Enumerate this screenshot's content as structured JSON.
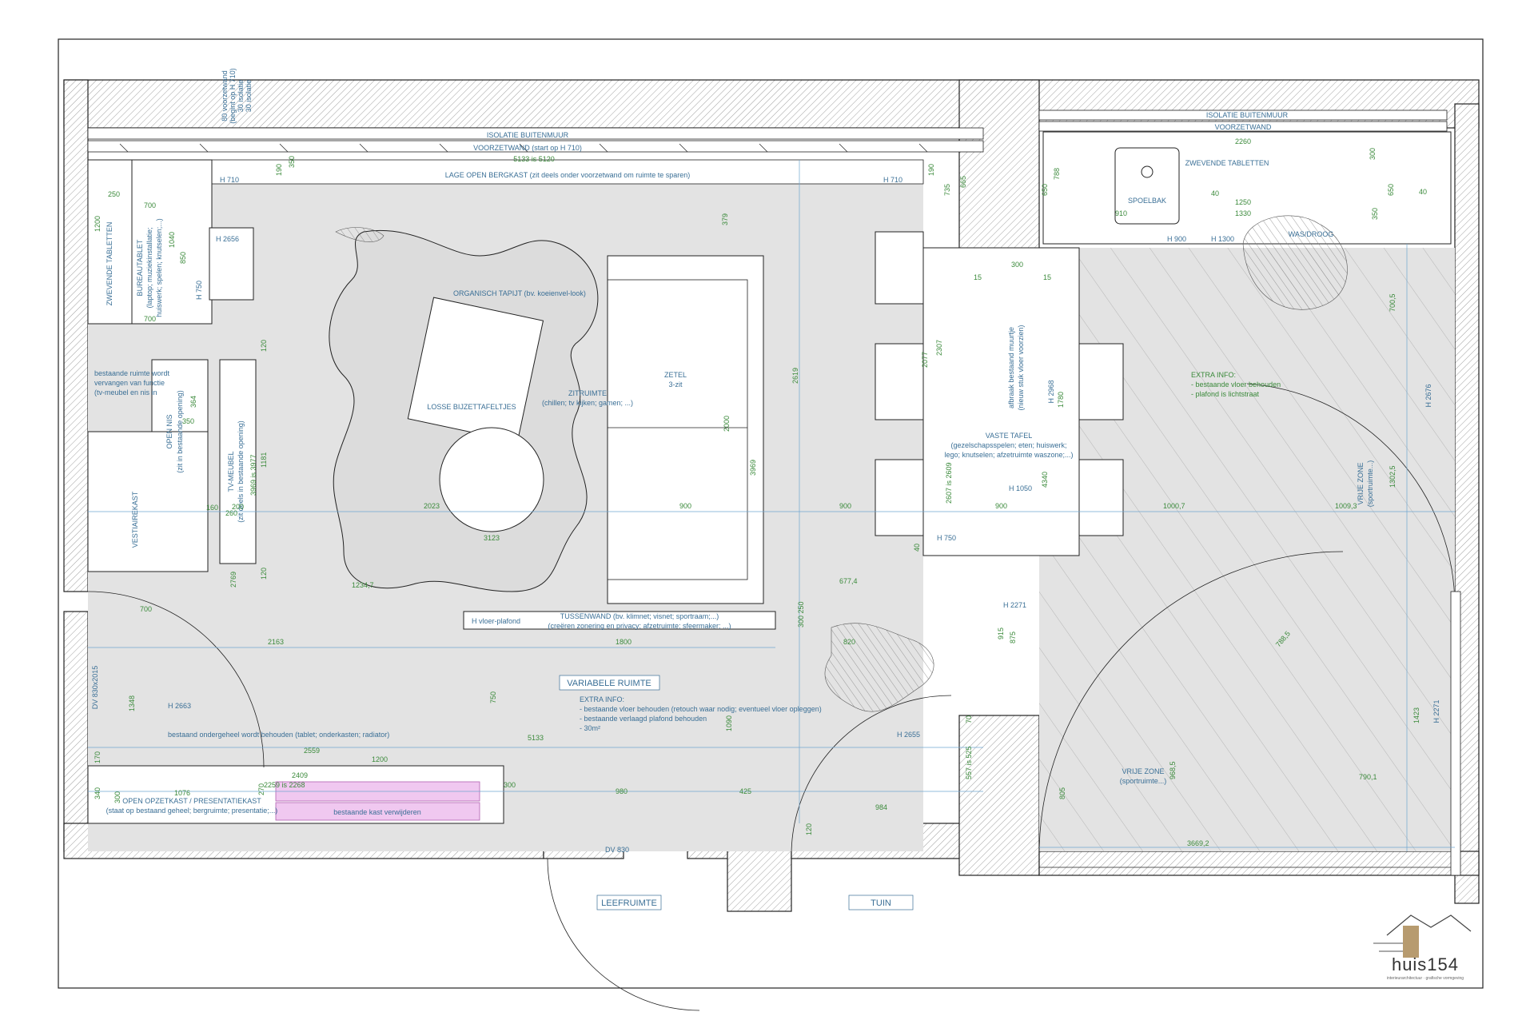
{
  "brand": {
    "name": "huis154",
    "tagline": "interieurarchitectuur · grafische vormgeving"
  },
  "room_tags": {
    "left": "LEEFRUIMTE",
    "right": "TUIN"
  },
  "labels": {
    "isolatie_left": "ISOLATIE BUITENMUUR",
    "voorzetwand_left": "VOORZETWAND (start op H 710)",
    "dim_5133": "5133 is 5120",
    "lage_kast": "LAGE OPEN BERGKAST (zit deels onder voorzetwand om ruimte te sparen)",
    "h710_a": "H 710",
    "h710_b": "H 710",
    "zwevende_l": "ZWEVENDE TABLETTEN",
    "bureau_1": "BUREAUTABLET",
    "bureau_2": "(laptop; muziekinstallatie;",
    "bureau_3": "huiswerk; spelen; knutselen;...)",
    "h2656": "H 2656",
    "h750_l": "H 750",
    "tapijt": "ORGANISCH TAPIJT (bv. koeienvel-look)",
    "bijzet": "LOSSE BIJZETTAFELTJES",
    "zit_1": "ZITRUIMTE",
    "zit_2": "(chillen; tv kijken; gamen; ...)",
    "zetel_1": "ZETEL",
    "zetel_2": "3-zit",
    "bestaande_1": "bestaande ruimte wordt",
    "bestaande_2": "vervangen van functie",
    "bestaande_3": "(tv-meubel en nis in",
    "open_nis": "OPEN NIS",
    "open_nis_sub": "(zit in bestaande opening)",
    "tv_1": "TV-MEUBEL",
    "tv_2": "(zit deels in bestaande opening)",
    "vestiaire": "VESTIAIREKAST",
    "tussenwand_1": "TUSSENWAND (bv. klimnet; visnet; sportraam;...)",
    "tussenwand_2": "(creëren zonering en privacy; afzetruimte; sfeermaker; ...)",
    "h_vloer": "H vloer-plafond",
    "variabele": "VARIABELE RUIMTE",
    "extra_1": "EXTRA INFO:",
    "extra_2": "- bestaande vloer behouden (retouch waar nodig; eventueel vloer opleggen)",
    "extra_3": "- bestaande verlaagd plafond behouden",
    "extra_4": "- 30m²",
    "h2663": "H 2663",
    "onderg": "bestaand ondergeheel wordt behouden (tablet; onderkasten; radiator)",
    "opzet_1": "OPEN OPZETKAST / PRESENTATIEKAST",
    "opzet_2": "(staat op bestaand geheel; bergruimte; presentatie;...)",
    "verwijder": "bestaande kast verwijderen",
    "dv_left": "DV 830x2015",
    "dv_bottom": "DV 830",
    "h2655": "H 2655",
    "h2271_a": "H 2271",
    "h2968": "H 2968",
    "afbraak_1": "afbraak bestaand muurtje",
    "afbraak_2": "(nieuw stuk vloer voorzien)",
    "vaste_1": "VASTE TAFEL",
    "vaste_2": "(gezelschapsspelen; eten; huiswerk;",
    "vaste_3": "lego; knutselen; afzetruimte waszone;...)",
    "h1050": "H 1050",
    "h750_t": "H 750",
    "isolatie_right": "ISOLATIE BUITENMUUR",
    "voorzetwand_right": "VOORZETWAND",
    "zwevende_r": "ZWEVENDE TABLETTEN",
    "spoelbak": "SPOELBAK",
    "wasdroog": "WAS/DROOG",
    "h900": "H 900",
    "h1300": "H 1300",
    "extra_r1": "EXTRA INFO:",
    "extra_r2": "- bestaande vloer behouden",
    "extra_r3": "- plafond is lichtstraat",
    "vrije_1": "VRIJE ZONE",
    "vrije_2": "(sportruimte...)",
    "vrije_v1": "VRIJE ZONE",
    "vrije_v2": "(sportruimte...)",
    "h2676": "H 2676",
    "h2271_b": "H 2271",
    "wall_note_1": "80 voorzetwand",
    "wall_note_2": "(begint op H 710)",
    "wall_note_3": "30 isolatie",
    "wall_note_4": "30 isolatie"
  },
  "dims": {
    "d250": "250",
    "d700a": "700",
    "d700b": "700",
    "d1200": "1200",
    "d1040": "1040",
    "d850": "850",
    "d190a": "190",
    "d350": "350",
    "d190b": "190",
    "d735": "735",
    "d665": "665",
    "d379": "379",
    "d120a": "120",
    "d364": "364",
    "d350b": "350",
    "d1181": "1181",
    "d3969a": "3969 is 3977",
    "d160": "160",
    "d260": "260",
    "d200": "200",
    "d2769": "2769",
    "d120b": "120",
    "d2023": "2023",
    "d3123": "3123",
    "d900a": "900",
    "d900b": "900",
    "d900c": "900",
    "d2000": "2000",
    "d3969b": "3969",
    "d2619": "2619",
    "d2077": "2077",
    "d2307": "2307",
    "d2607": "2607 is 2609",
    "d4340": "4340",
    "d1780": "1780",
    "d1234": "1234,7",
    "d677": "677,4",
    "d2163": "2163",
    "d1800": "1800",
    "d820": "820",
    "d700c": "700",
    "d1348": "1348",
    "d750": "750",
    "d5133": "5133",
    "d2559": "2559",
    "d1200b": "1200",
    "d2409": "2409",
    "d2259": "2259 is 2268",
    "d270": "270",
    "d1076": "1076",
    "d340": "340",
    "d300a": "300",
    "d300b": "300",
    "d170": "170",
    "d980": "980",
    "d425": "425",
    "d984": "984",
    "d1090": "1090",
    "d557": "557 is 525",
    "d915": "915",
    "d875": "875",
    "d70": "70",
    "d300c": "300",
    "d15a": "15",
    "d15b": "15",
    "d300_250": "300 250",
    "d2260": "2260",
    "d300d": "300",
    "d1250": "1250",
    "d1330": "1330",
    "d910": "910",
    "d40a": "40",
    "d40b": "40",
    "d40c": "40",
    "d788": "788",
    "d650a": "650",
    "d650b": "650",
    "d350c": "350",
    "d700_5": "700,5",
    "d1000": "1000,7",
    "d1009": "1009,3",
    "d1302": "1302,5",
    "d788_5": "788,5",
    "d968": "968,5",
    "d805": "805",
    "d790": "790,1",
    "d1423": "1423",
    "d3669": "3669,2",
    "d120c": "120"
  },
  "colors": {
    "label": "#3a6f96",
    "dimension": "#3b8a3b",
    "dimline": "#6fa6d0",
    "floor": "#e3e3e3",
    "highlight": "#f0c8f0"
  }
}
